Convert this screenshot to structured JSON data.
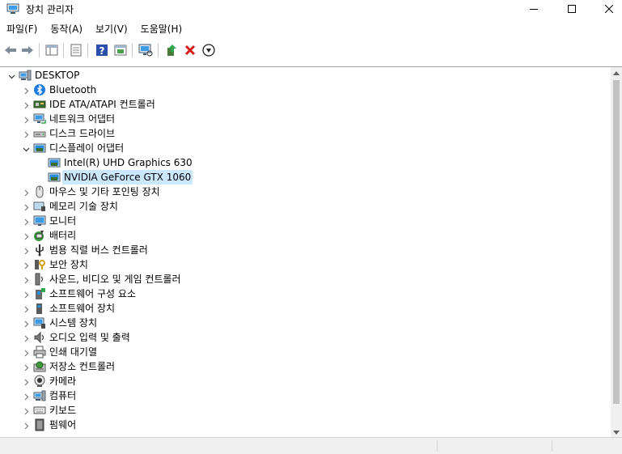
{
  "window": {
    "title": "장치 관리자",
    "controls": {
      "minimize": "minimize",
      "maximize": "maximize",
      "close": "close"
    }
  },
  "menu": [
    "파일(F)",
    "동작(A)",
    "보기(V)",
    "도움말(H)"
  ],
  "toolbar": [
    {
      "name": "back",
      "icon": "arrow-left-icon"
    },
    {
      "name": "forward",
      "icon": "arrow-right-icon"
    },
    {
      "name": "show-hide-console-tree",
      "icon": "console-tree-icon"
    },
    {
      "name": "properties",
      "icon": "properties-icon"
    },
    {
      "name": "help",
      "icon": "help-icon"
    },
    {
      "name": "action-pane",
      "icon": "action-pane-icon"
    },
    {
      "name": "scan-hardware",
      "icon": "monitor-scan-icon"
    },
    {
      "name": "update-driver",
      "icon": "update-driver-icon"
    },
    {
      "name": "uninstall-device",
      "icon": "red-x-icon"
    },
    {
      "name": "disable-device",
      "icon": "down-arrow-circle-icon"
    }
  ],
  "tree": {
    "root": {
      "label": "DESKTOP",
      "icon": "computer-icon",
      "expanded": true
    },
    "categories": [
      {
        "label": "Bluetooth",
        "icon": "bluetooth-icon",
        "expanded": false
      },
      {
        "label": "IDE ATA/ATAPI 컨트롤러",
        "icon": "ide-controller-icon",
        "expanded": false
      },
      {
        "label": "네트워크 어댑터",
        "icon": "network-adapter-icon",
        "expanded": false
      },
      {
        "label": "디스크 드라이브",
        "icon": "disk-drive-icon",
        "expanded": false
      },
      {
        "label": "디스플레이 어댑터",
        "icon": "display-adapter-icon",
        "expanded": true,
        "children": [
          {
            "label": "Intel(R) UHD Graphics 630",
            "icon": "display-adapter-icon",
            "selected": false
          },
          {
            "label": "NVIDIA GeForce GTX 1060",
            "icon": "display-adapter-icon",
            "selected": true
          }
        ]
      },
      {
        "label": "마우스 및 기타 포인팅 장치",
        "icon": "mouse-icon",
        "expanded": false
      },
      {
        "label": "메모리 기술 장치",
        "icon": "memory-device-icon",
        "expanded": false
      },
      {
        "label": "모니터",
        "icon": "monitor-icon",
        "expanded": false
      },
      {
        "label": "배터리",
        "icon": "battery-icon",
        "expanded": false
      },
      {
        "label": "범용 직렬 버스 컨트롤러",
        "icon": "usb-controller-icon",
        "expanded": false
      },
      {
        "label": "보안 장치",
        "icon": "security-device-icon",
        "expanded": false
      },
      {
        "label": "사운드, 비디오 및 게임 컨트롤러",
        "icon": "sound-icon",
        "expanded": false
      },
      {
        "label": "소프트웨어 구성 요소",
        "icon": "software-component-icon",
        "expanded": false
      },
      {
        "label": "소프트웨어 장치",
        "icon": "software-device-icon",
        "expanded": false
      },
      {
        "label": "시스템 장치",
        "icon": "system-device-icon",
        "expanded": false
      },
      {
        "label": "오디오 입력 및 출력",
        "icon": "audio-io-icon",
        "expanded": false
      },
      {
        "label": "인쇄 대기열",
        "icon": "print-queue-icon",
        "expanded": false
      },
      {
        "label": "저장소 컨트롤러",
        "icon": "storage-controller-icon",
        "expanded": false
      },
      {
        "label": "카메라",
        "icon": "camera-icon",
        "expanded": false
      },
      {
        "label": "컴퓨터",
        "icon": "computer-icon",
        "expanded": false
      },
      {
        "label": "키보드",
        "icon": "keyboard-icon",
        "expanded": false
      },
      {
        "label": "펌웨어",
        "icon": "firmware-icon",
        "expanded": false
      }
    ]
  },
  "colors": {
    "selection": "#cce8ff",
    "scrollbar_track": "#f0f0f0",
    "scrollbar_thumb": "#c2c2c2"
  }
}
